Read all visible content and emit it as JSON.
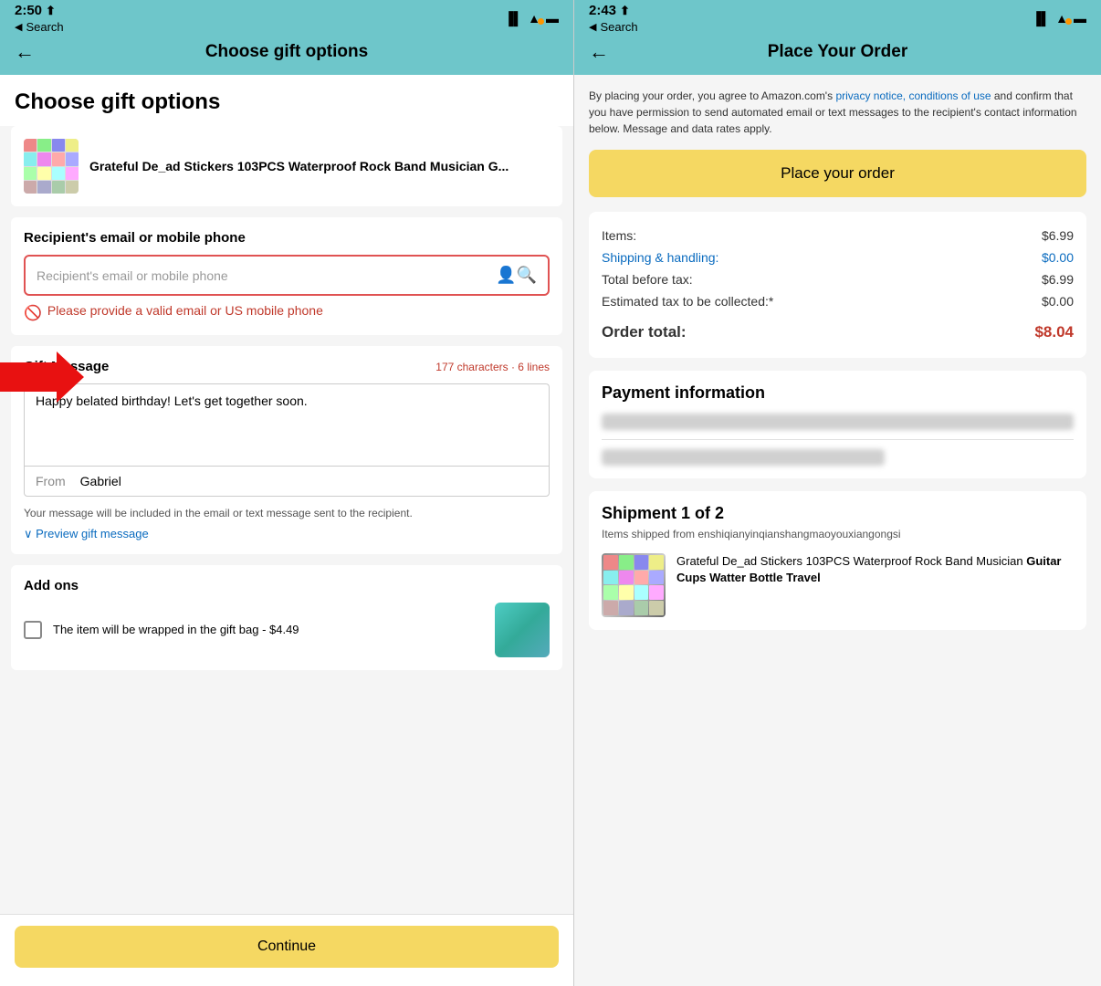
{
  "left_phone": {
    "status": {
      "time": "2:50",
      "nav_icon": "✈",
      "search_back": "◀",
      "search_label": "Search",
      "signal": "▐▌",
      "wifi": "wifi",
      "battery": "🔋"
    },
    "nav": {
      "back_icon": "←",
      "title": "Choose gift options"
    },
    "page_heading": "Choose gift options",
    "product": {
      "name": "Grateful De_ad Stickers 103PCS Waterproof Rock Band Musician G..."
    },
    "recipient_section": {
      "label": "Recipient's email or mobile phone",
      "input_placeholder": "Recipient's email or mobile phone",
      "error": "Please provide a valid email or US mobile phone"
    },
    "gift_message": {
      "label": "Gift Message",
      "count": "177 characters · 6 lines",
      "message": "Happy belated birthday! Let's get together soon.",
      "from_label": "From",
      "from_value": "Gabriel",
      "note": "Your message will be included in the email or text message sent to the recipient.",
      "preview": "∨ Preview gift message"
    },
    "addons": {
      "label": "Add ons",
      "item_text": "The item will be wrapped in the gift bag - $4.49"
    },
    "continue_button": "Continue"
  },
  "right_phone": {
    "status": {
      "time": "2:43",
      "nav_icon": "✈",
      "search_back": "◀",
      "search_label": "Search"
    },
    "nav": {
      "back_icon": "←",
      "title": "Place Your Order"
    },
    "legal_text_part1": "By placing your order, you agree to Amazon.com's ",
    "legal_link1": "privacy notice,",
    "legal_link2": "conditions of use",
    "legal_text_part2": " and confirm that you have permission to send automated email or text messages to the recipient's contact information below. Message and data rates apply.",
    "place_order_button": "Place your order",
    "order_summary": {
      "items_label": "Items:",
      "items_value": "$6.99",
      "shipping_label": "Shipping & handling:",
      "shipping_value": "$0.00",
      "total_before_tax_label": "Total before tax:",
      "total_before_tax_value": "$6.99",
      "estimated_tax_label": "Estimated tax to be collected:*",
      "estimated_tax_value": "$0.00",
      "order_total_label": "Order total:",
      "order_total_value": "$8.04"
    },
    "payment_section": {
      "heading": "Payment information"
    },
    "shipment": {
      "title": "Shipment 1 of 2",
      "subtitle": "Items shipped from enshiqianyinqianshangmaoyouxiangongsi",
      "product_name": "Grateful De_ad Stickers 103PCS Waterproof Rock Band Musician Guitar Cups Watter Bottle Travel"
    }
  }
}
